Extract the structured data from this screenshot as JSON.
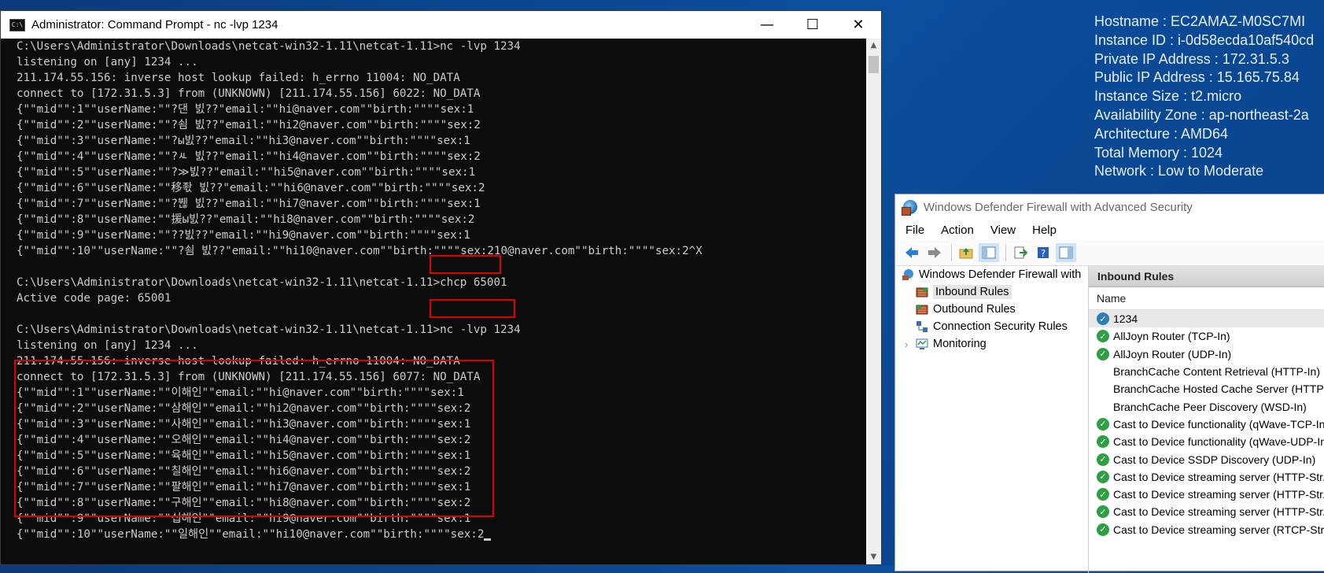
{
  "sysinfo": [
    "Hostname : EC2AMAZ-M0SC7MI",
    "Instance ID : i-0d58ecda10af540cd",
    "Private IP Address : 172.31.5.3",
    "Public IP Address : 15.165.75.84",
    "Instance Size : t2.micro",
    "Availability Zone : ap-northeast-2a",
    "Architecture : AMD64",
    "Total Memory : 1024",
    "Network : Low to Moderate"
  ],
  "cmd": {
    "title": "Administrator: Command Prompt - nc  -lvp 1234",
    "icon_label": "C:\\",
    "minimize_glyph": "—",
    "maximize_glyph": "☐",
    "close_glyph": "✕",
    "lines": [
      "C:\\Users\\Administrator\\Downloads\\netcat-win32-1.11\\netcat-1.11>nc -lvp 1234",
      "listening on [any] 1234 ...",
      "211.174.55.156: inverse host lookup failed: h_errno 11004: NO_DATA",
      "connect to [172.31.5.3] from (UNKNOWN) [211.174.55.156] 6022: NO_DATA",
      "{\"\"mid\"\":1\"\"userName:\"\"?댄 빐??\"email:\"\"hi@naver.com\"\"birth:\"\"\"\"sex:1",
      "{\"\"mid\"\":2\"\"userName:\"\"?쇰 빐??\"email:\"\"hi2@naver.com\"\"birth:\"\"\"\"sex:2",
      "{\"\"mid\"\":3\"\"userName:\"\"?ы빐??\"email:\"\"hi3@naver.com\"\"birth:\"\"\"\"sex:1",
      "{\"\"mid\"\":4\"\"userName:\"\"?ㅻ 빐??\"email:\"\"hi4@naver.com\"\"birth:\"\"\"\"sex:2",
      "{\"\"mid\"\":5\"\"userName:\"\"?≫빐??\"email:\"\"hi5@naver.com\"\"birth:\"\"\"\"sex:1",
      "{\"\"mid\"\":6\"\"userName:\"\"移좏 빐??\"email:\"\"hi6@naver.com\"\"birth:\"\"\"\"sex:2",
      "{\"\"mid\"\":7\"\"userName:\"\"?붾 빐??\"email:\"\"hi7@naver.com\"\"birth:\"\"\"\"sex:1",
      "{\"\"mid\"\":8\"\"userName:\"\"援ы빐??\"email:\"\"hi8@naver.com\"\"birth:\"\"\"\"sex:2",
      "{\"\"mid\"\":9\"\"userName:\"\"??빐??\"email:\"\"hi9@naver.com\"\"birth:\"\"\"\"sex:1",
      "{\"\"mid\"\":10\"\"userName:\"\"?쇰 빐??\"email:\"\"hi10@naver.com\"\"birth:\"\"\"\"sex:210@naver.com\"\"birth:\"\"\"\"sex:2^X",
      "",
      "C:\\Users\\Administrator\\Downloads\\netcat-win32-1.11\\netcat-1.11>chcp 65001",
      "Active code page: 65001",
      "",
      "C:\\Users\\Administrator\\Downloads\\netcat-win32-1.11\\netcat-1.11>nc -lvp 1234",
      "listening on [any] 1234 ...",
      "211.174.55.156: inverse host lookup failed: h_errno 11004: NO_DATA",
      "connect to [172.31.5.3] from (UNKNOWN) [211.174.55.156] 6077: NO_DATA",
      "{\"\"mid\"\":1\"\"userName:\"\"이해인\"\"email:\"\"hi@naver.com\"\"birth:\"\"\"\"sex:1",
      "{\"\"mid\"\":2\"\"userName:\"\"삼해인\"\"email:\"\"hi2@naver.com\"\"birth:\"\"\"\"sex:2",
      "{\"\"mid\"\":3\"\"userName:\"\"사해인\"\"email:\"\"hi3@naver.com\"\"birth:\"\"\"\"sex:1",
      "{\"\"mid\"\":4\"\"userName:\"\"오해인\"\"email:\"\"hi4@naver.com\"\"birth:\"\"\"\"sex:2",
      "{\"\"mid\"\":5\"\"userName:\"\"육해인\"\"email:\"\"hi5@naver.com\"\"birth:\"\"\"\"sex:1",
      "{\"\"mid\"\":6\"\"userName:\"\"칠해인\"\"email:\"\"hi6@naver.com\"\"birth:\"\"\"\"sex:2",
      "{\"\"mid\"\":7\"\"userName:\"\"팔해인\"\"email:\"\"hi7@naver.com\"\"birth:\"\"\"\"sex:1",
      "{\"\"mid\"\":8\"\"userName:\"\"구해인\"\"email:\"\"hi8@naver.com\"\"birth:\"\"\"\"sex:2",
      "{\"\"mid\"\":9\"\"userName:\"\"십해인\"\"email:\"\"hi9@naver.com\"\"birth:\"\"\"\"sex:1",
      "{\"\"mid\"\":10\"\"userName:\"\"일해인\"\"email:\"\"hi10@naver.com\"\"birth:\"\"\"\"sex:2"
    ]
  },
  "firewall": {
    "title": "Windows Defender Firewall with Advanced Security",
    "menu": [
      "File",
      "Action",
      "View",
      "Help"
    ],
    "tree": [
      {
        "label": "Windows Defender Firewall with",
        "icon": "firewall-icon",
        "indent": 0,
        "selected": false
      },
      {
        "label": "Inbound Rules",
        "icon": "inbound-rules-icon",
        "indent": 1,
        "selected": true
      },
      {
        "label": "Outbound Rules",
        "icon": "outbound-rules-icon",
        "indent": 1,
        "selected": false
      },
      {
        "label": "Connection Security Rules",
        "icon": "connection-security-icon",
        "indent": 1,
        "selected": false
      },
      {
        "label": "Monitoring",
        "icon": "monitoring-icon",
        "indent": 1,
        "selected": false,
        "expander": "›"
      }
    ],
    "panel_title": "Inbound Rules",
    "column_name": "Name",
    "rules": [
      {
        "name": "1234",
        "status": "blue",
        "selected": true
      },
      {
        "name": "AllJoyn Router (TCP-In)",
        "status": "green"
      },
      {
        "name": "AllJoyn Router (UDP-In)",
        "status": "green"
      },
      {
        "name": "BranchCache Content Retrieval (HTTP-In)",
        "status": "none"
      },
      {
        "name": "BranchCache Hosted Cache Server (HTTP-In)",
        "status": "none"
      },
      {
        "name": "BranchCache Peer Discovery (WSD-In)",
        "status": "none"
      },
      {
        "name": "Cast to Device functionality (qWave-TCP-In)",
        "status": "green"
      },
      {
        "name": "Cast to Device functionality (qWave-UDP-In)",
        "status": "green"
      },
      {
        "name": "Cast to Device SSDP Discovery (UDP-In)",
        "status": "green"
      },
      {
        "name": "Cast to Device streaming server (HTTP-Str...",
        "status": "green"
      },
      {
        "name": "Cast to Device streaming server (HTTP-Str...",
        "status": "green"
      },
      {
        "name": "Cast to Device streaming server (HTTP-Str...",
        "status": "green"
      },
      {
        "name": "Cast to Device streaming server (RTCP-Stre...",
        "status": "green"
      }
    ]
  },
  "colors": {
    "highlight_box": "#e00000",
    "console_text": "#cccccc",
    "desktop_blue": "#0b4f9e"
  }
}
